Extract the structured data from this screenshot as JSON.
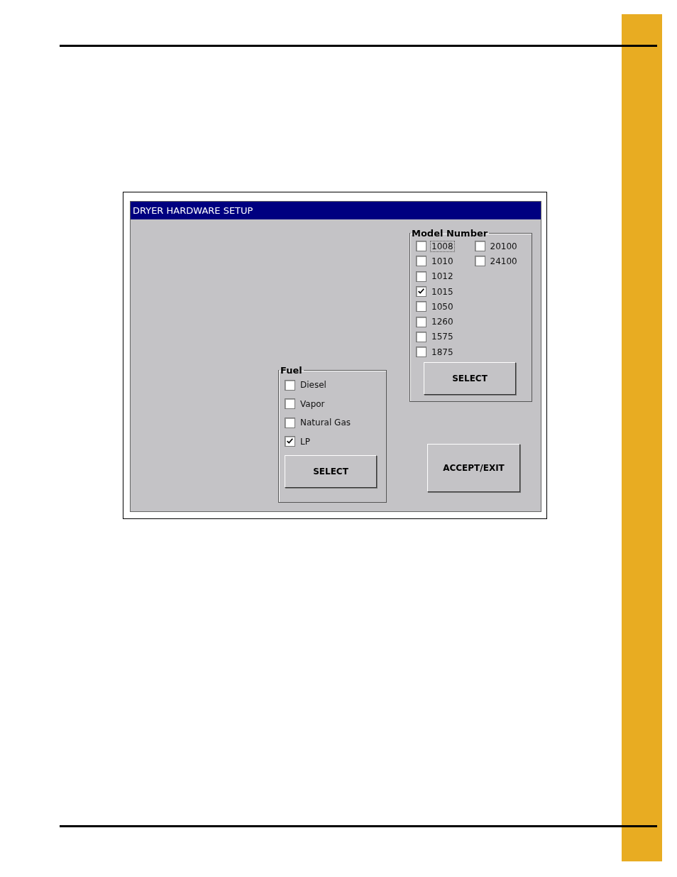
{
  "window": {
    "title": "DRYER HARDWARE SETUP"
  },
  "fuel": {
    "label": "Fuel",
    "options": [
      {
        "label": "Diesel",
        "checked": false
      },
      {
        "label": "Vapor",
        "checked": false
      },
      {
        "label": "Natural Gas",
        "checked": false
      },
      {
        "label": "LP",
        "checked": true
      }
    ],
    "button": "SELECT"
  },
  "model_number": {
    "label": "Model Number",
    "columns": [
      [
        {
          "label": "1008",
          "checked": false,
          "focused": true
        },
        {
          "label": "1010",
          "checked": false,
          "focused": false
        },
        {
          "label": "1012",
          "checked": false,
          "focused": false
        },
        {
          "label": "1015",
          "checked": true,
          "focused": false
        },
        {
          "label": "1050",
          "checked": false,
          "focused": false
        },
        {
          "label": "1260",
          "checked": false,
          "focused": false
        },
        {
          "label": "1575",
          "checked": false,
          "focused": false
        },
        {
          "label": "1875",
          "checked": false,
          "focused": false
        }
      ],
      [
        {
          "label": "20100",
          "checked": false,
          "focused": false
        },
        {
          "label": "24100",
          "checked": false,
          "focused": false
        }
      ]
    ],
    "button": "SELECT"
  },
  "accept_button": "ACCEPT/EXIT"
}
